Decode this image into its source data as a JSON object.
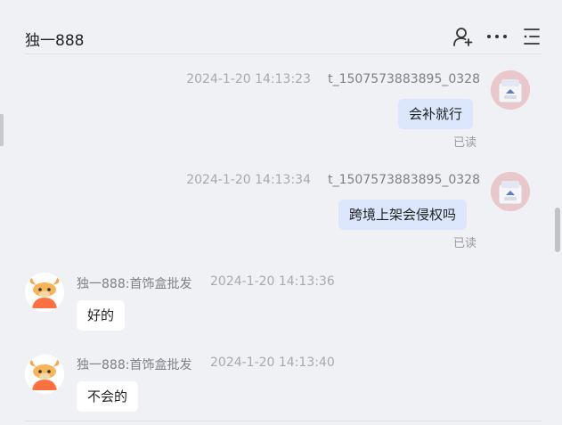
{
  "header": {
    "title": "独一888",
    "icons": [
      "user-plus-icon",
      "more-icon",
      "menu-icon"
    ]
  },
  "messages": [
    {
      "direction": "out",
      "time": "2024-1-20 14:13:23",
      "sender": "t_1507573883895_0328",
      "text": "会补就行",
      "status": "已读"
    },
    {
      "direction": "out",
      "time": "2024-1-20 14:13:34",
      "sender": "t_1507573883895_0328",
      "text": "跨境上架会侵权吗",
      "status": "已读"
    },
    {
      "direction": "in",
      "sender": "独一888:首饰盒批发",
      "time": "2024-1-20 14:13:36",
      "text": "好的"
    },
    {
      "direction": "in",
      "sender": "独一888:首饰盒批发",
      "time": "2024-1-20 14:13:40",
      "text": "不会的"
    }
  ],
  "colors": {
    "background": "#f0f1f5",
    "outgoing_bubble": "#dce6fd",
    "incoming_bubble": "#ffffff",
    "meta_text": "#a7a9b0"
  }
}
